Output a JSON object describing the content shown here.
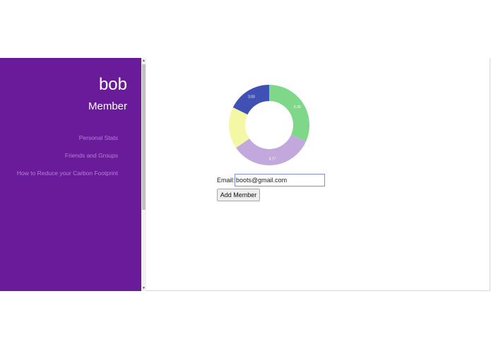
{
  "sidebar": {
    "user_name": "bob",
    "user_role": "Member",
    "nav_items": [
      {
        "label": "Personal Stats"
      },
      {
        "label": "Friends and Groups"
      },
      {
        "label": "How to Reduce your Carbon Footprint"
      }
    ],
    "background_color": "#6a1b9a"
  },
  "chart_data": {
    "type": "pie",
    "style": "donut",
    "slices": [
      {
        "label": "5.39",
        "value": 5.39,
        "color": "#7fd88a"
      },
      {
        "label": "5.77",
        "value": 5.77,
        "color": "#c2a8dc"
      },
      {
        "label": "",
        "value": 2.87,
        "color": "#f4f7a3"
      },
      {
        "label": "3.03",
        "value": 3.03,
        "color": "#3f51b5"
      }
    ]
  },
  "form": {
    "email_label": "Email:",
    "email_value": "boots@gmail.com",
    "add_button_label": "Add Member"
  },
  "scrollbar": {
    "up_arrow": "▲",
    "down_arrow": "▼"
  }
}
